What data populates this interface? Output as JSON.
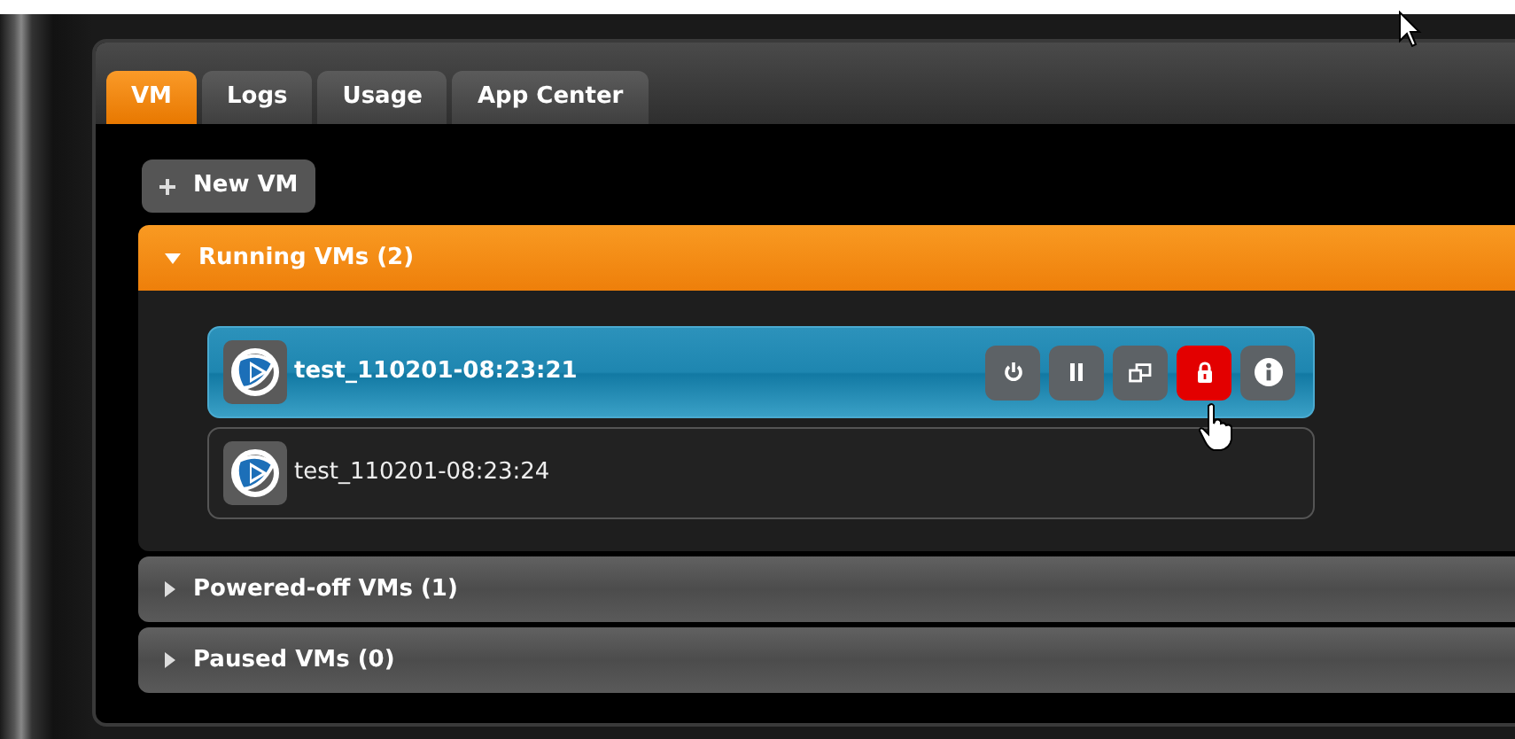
{
  "tabs": [
    {
      "label": "VM",
      "selected": true
    },
    {
      "label": "Logs",
      "selected": false
    },
    {
      "label": "Usage",
      "selected": false
    },
    {
      "label": "App Center",
      "selected": false
    }
  ],
  "new_vm_button": {
    "label": "New VM"
  },
  "sections": [
    {
      "title": "Running VMs (2)",
      "expanded": true,
      "vms": [
        {
          "name": "test_110201-08:23:21",
          "selected": true,
          "actions": [
            {
              "kind": "power",
              "highlighted": false
            },
            {
              "kind": "pause",
              "highlighted": false
            },
            {
              "kind": "console",
              "highlighted": false
            },
            {
              "kind": "lock",
              "highlighted": true
            },
            {
              "kind": "info",
              "highlighted": false
            }
          ]
        },
        {
          "name": "test_110201-08:23:24",
          "selected": false
        }
      ]
    },
    {
      "title": "Powered-off VMs (1)",
      "expanded": false
    },
    {
      "title": "Paused VMs (0)",
      "expanded": false
    }
  ]
}
